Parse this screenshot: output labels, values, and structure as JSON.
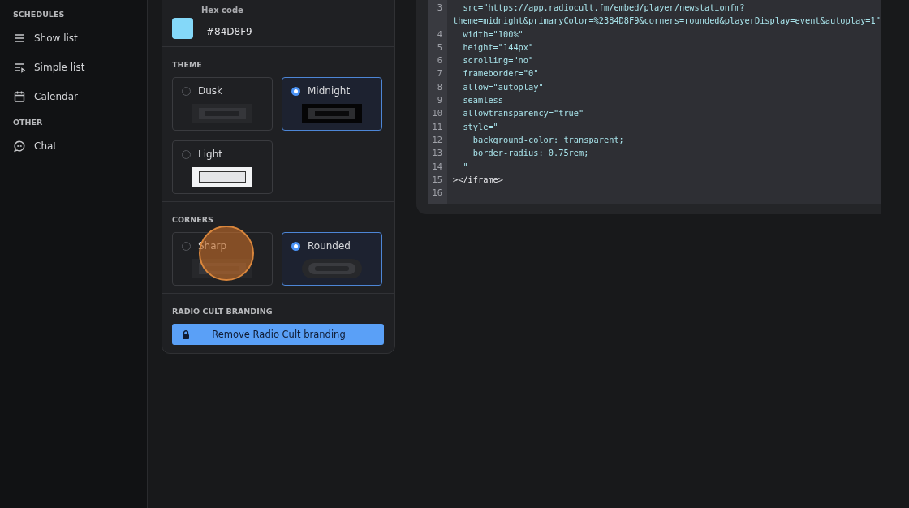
{
  "sidebar": {
    "sections": [
      {
        "title": "SCHEDULES",
        "items": [
          {
            "label": "Show list",
            "kind": "lines"
          },
          {
            "label": "Simple list",
            "kind": "playlist"
          },
          {
            "label": "Calendar",
            "kind": "calendar"
          }
        ]
      },
      {
        "title": "OTHER",
        "items": [
          {
            "label": "Chat",
            "kind": "chat"
          }
        ]
      }
    ]
  },
  "settings": {
    "hex": {
      "label": "Hex code",
      "value": "#84D8F9",
      "color": "#84d8f9"
    },
    "theme": {
      "title": "THEME",
      "options": [
        {
          "label": "Dusk",
          "selected": false,
          "kind": "dusk"
        },
        {
          "label": "Midnight",
          "selected": true,
          "kind": "midnight"
        },
        {
          "label": "Light",
          "selected": false,
          "kind": "light"
        }
      ]
    },
    "corners": {
      "title": "CORNERS",
      "options": [
        {
          "label": "Sharp",
          "selected": false,
          "kind": "sharp"
        },
        {
          "label": "Rounded",
          "selected": true,
          "kind": "rounded"
        }
      ]
    },
    "branding": {
      "title": "RADIO CULT BRANDING",
      "button": "Remove Radio Cult branding"
    }
  },
  "code": {
    "lines": [
      {
        "number": "3",
        "text": "  src=\"https://app.radiocult.fm/embed/player/newstationfm?",
        "wrap": "theme=midnight&primaryColor=%2384D8F9&corners=rounded&playerDisplay=event&autoplay=1\"",
        "kind": "attr"
      },
      {
        "number": "4",
        "text": "  width=\"100%\"",
        "kind": "attr"
      },
      {
        "number": "5",
        "text": "  height=\"144px\"",
        "kind": "attr"
      },
      {
        "number": "6",
        "text": "  scrolling=\"no\"",
        "kind": "attr"
      },
      {
        "number": "7",
        "text": "  frameborder=\"0\"",
        "kind": "attr"
      },
      {
        "number": "8",
        "text": "  allow=\"autoplay\"",
        "kind": "attr"
      },
      {
        "number": "9",
        "text": "  seamless",
        "kind": "attr"
      },
      {
        "number": "10",
        "text": "  allowtransparency=\"true\"",
        "kind": "attr"
      },
      {
        "number": "11",
        "text": "  style=\"",
        "kind": "attr"
      },
      {
        "number": "12",
        "text": "    background-color: transparent;",
        "kind": "attr"
      },
      {
        "number": "13",
        "text": "    border-radius: 0.75rem;",
        "kind": "attr"
      },
      {
        "number": "14",
        "text": "  \"",
        "kind": "attr"
      },
      {
        "number": "15",
        "text": "></iframe>",
        "kind": "tag"
      },
      {
        "number": "16",
        "kind": "attr"
      }
    ]
  }
}
